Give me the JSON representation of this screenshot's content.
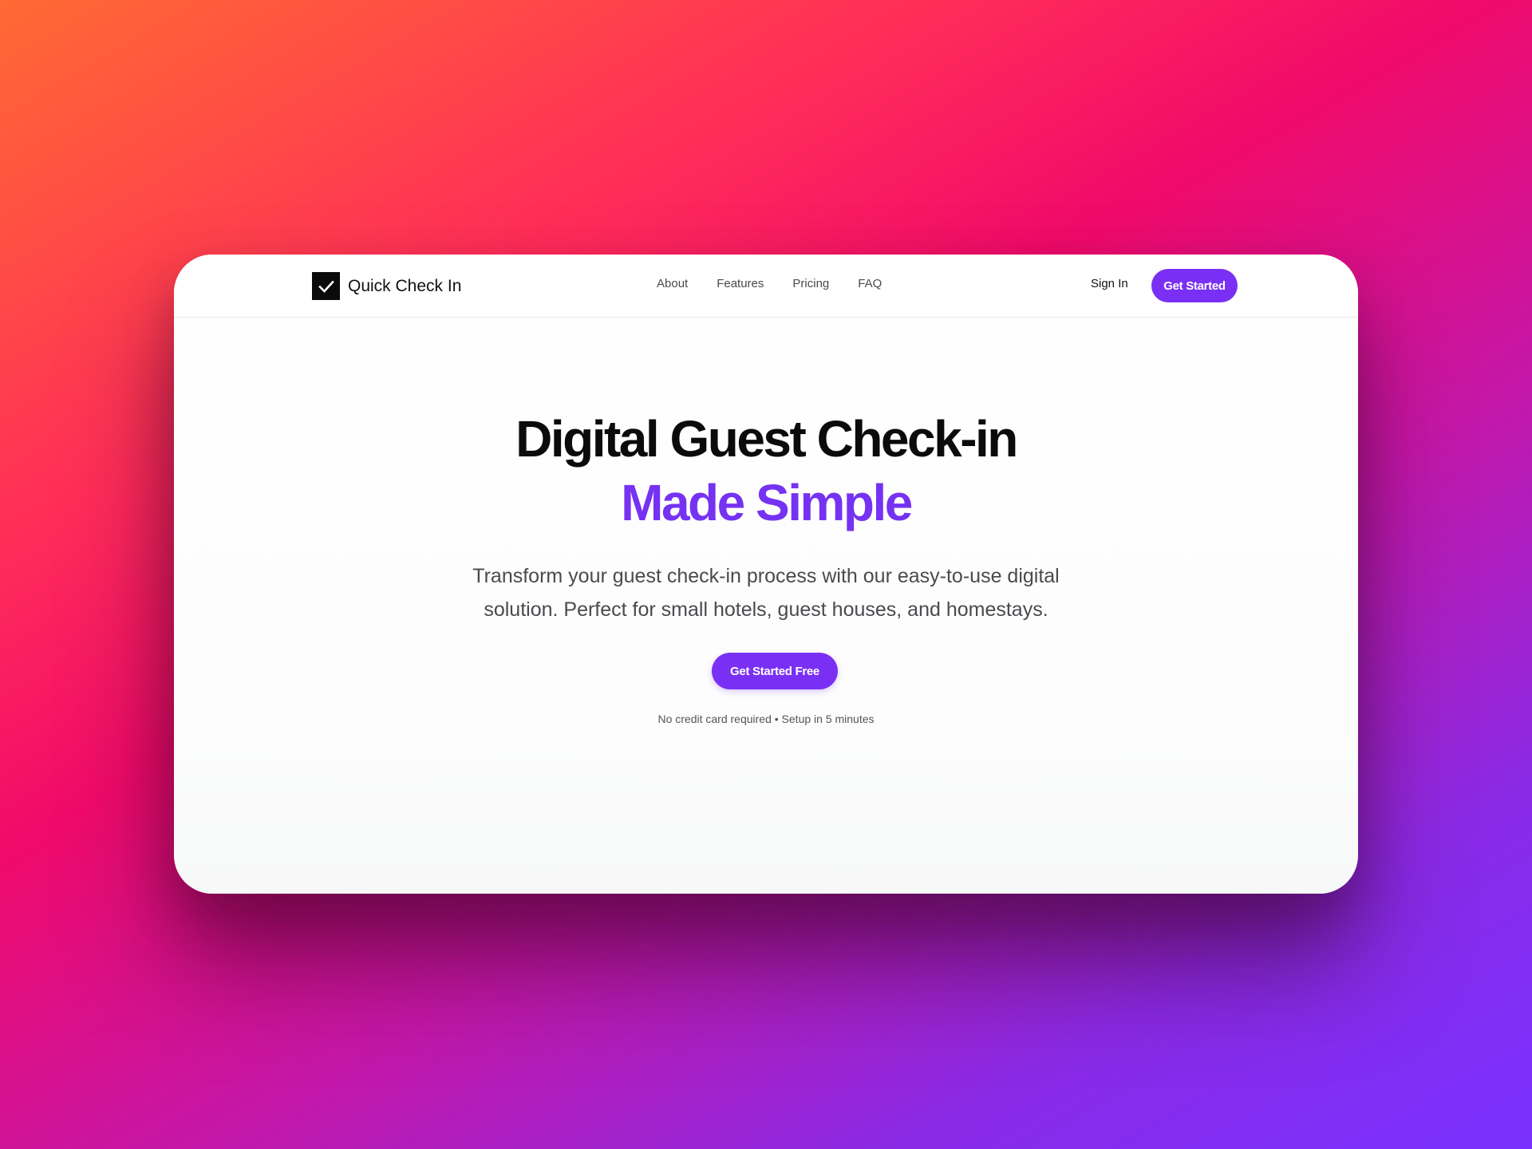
{
  "brand": {
    "name": "Quick Check In",
    "logo_icon": "checkmark-icon"
  },
  "nav": {
    "links": [
      "About",
      "Features",
      "Pricing",
      "FAQ"
    ],
    "sign_in": "Sign In",
    "cta": "Get Started"
  },
  "hero": {
    "headline_line1": "Digital Guest Check-in",
    "headline_line2": "Made Simple",
    "subtitle": "Transform your guest check-in process with our easy-to-use digital solution. Perfect for small hotels, guest houses, and homestays.",
    "cta": "Get Started Free",
    "fineprint": "No credit card required • Setup in 5 minutes"
  },
  "colors": {
    "accent": "#7a30f4",
    "headline": "#0b0b0c",
    "headline_accent": "#7532f2",
    "background_gradient": [
      "#ff6a33",
      "#f00a6a",
      "#7a31ff"
    ]
  }
}
